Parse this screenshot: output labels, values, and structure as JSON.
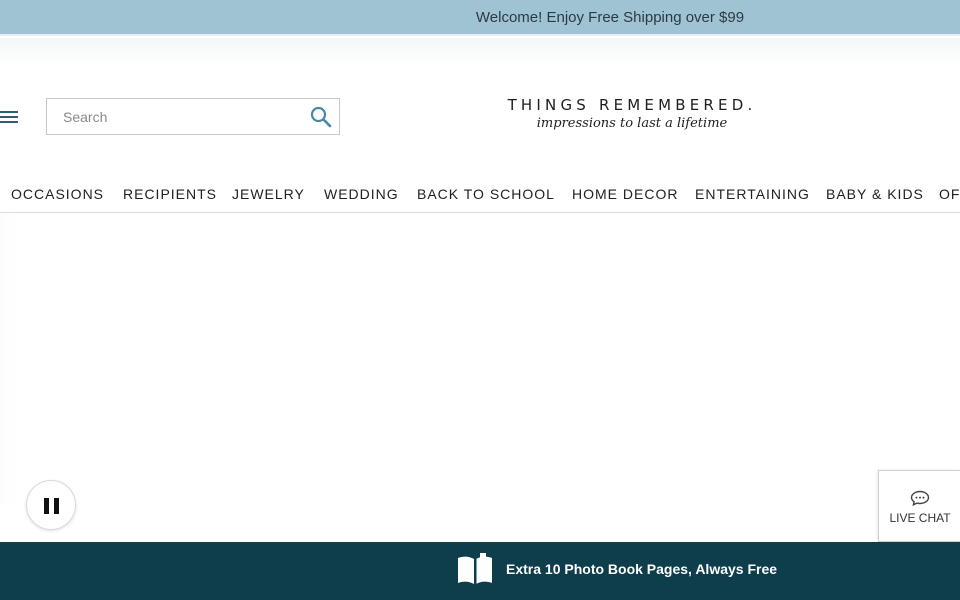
{
  "promo": {
    "text": "Welcome! Enjoy Free Shipping over $99"
  },
  "search": {
    "placeholder": "Search",
    "value": ""
  },
  "logo": {
    "name": "THINGS REMEMBERED.",
    "tagline": "impressions to last a lifetime"
  },
  "nav": {
    "items": [
      "OCCASIONS",
      "RECIPIENTS",
      "JEWELRY",
      "WEDDING",
      "BACK TO SCHOOL",
      "HOME DECOR",
      "ENTERTAINING",
      "BABY & KIDS",
      "OF"
    ]
  },
  "chat": {
    "label": "LIVE CHAT"
  },
  "banner": {
    "text": "Extra 10 Photo Book Pages, Always Free"
  },
  "icons": {
    "menu": "hamburger-menu-icon",
    "search": "search-icon",
    "pause": "pause-icon",
    "chat": "chat-bubble-icon",
    "book": "open-book-icon"
  },
  "colors": {
    "promo_bg": "#9fc3d3",
    "banner_bg": "#0e3d4c",
    "accent": "#2f5d74"
  }
}
